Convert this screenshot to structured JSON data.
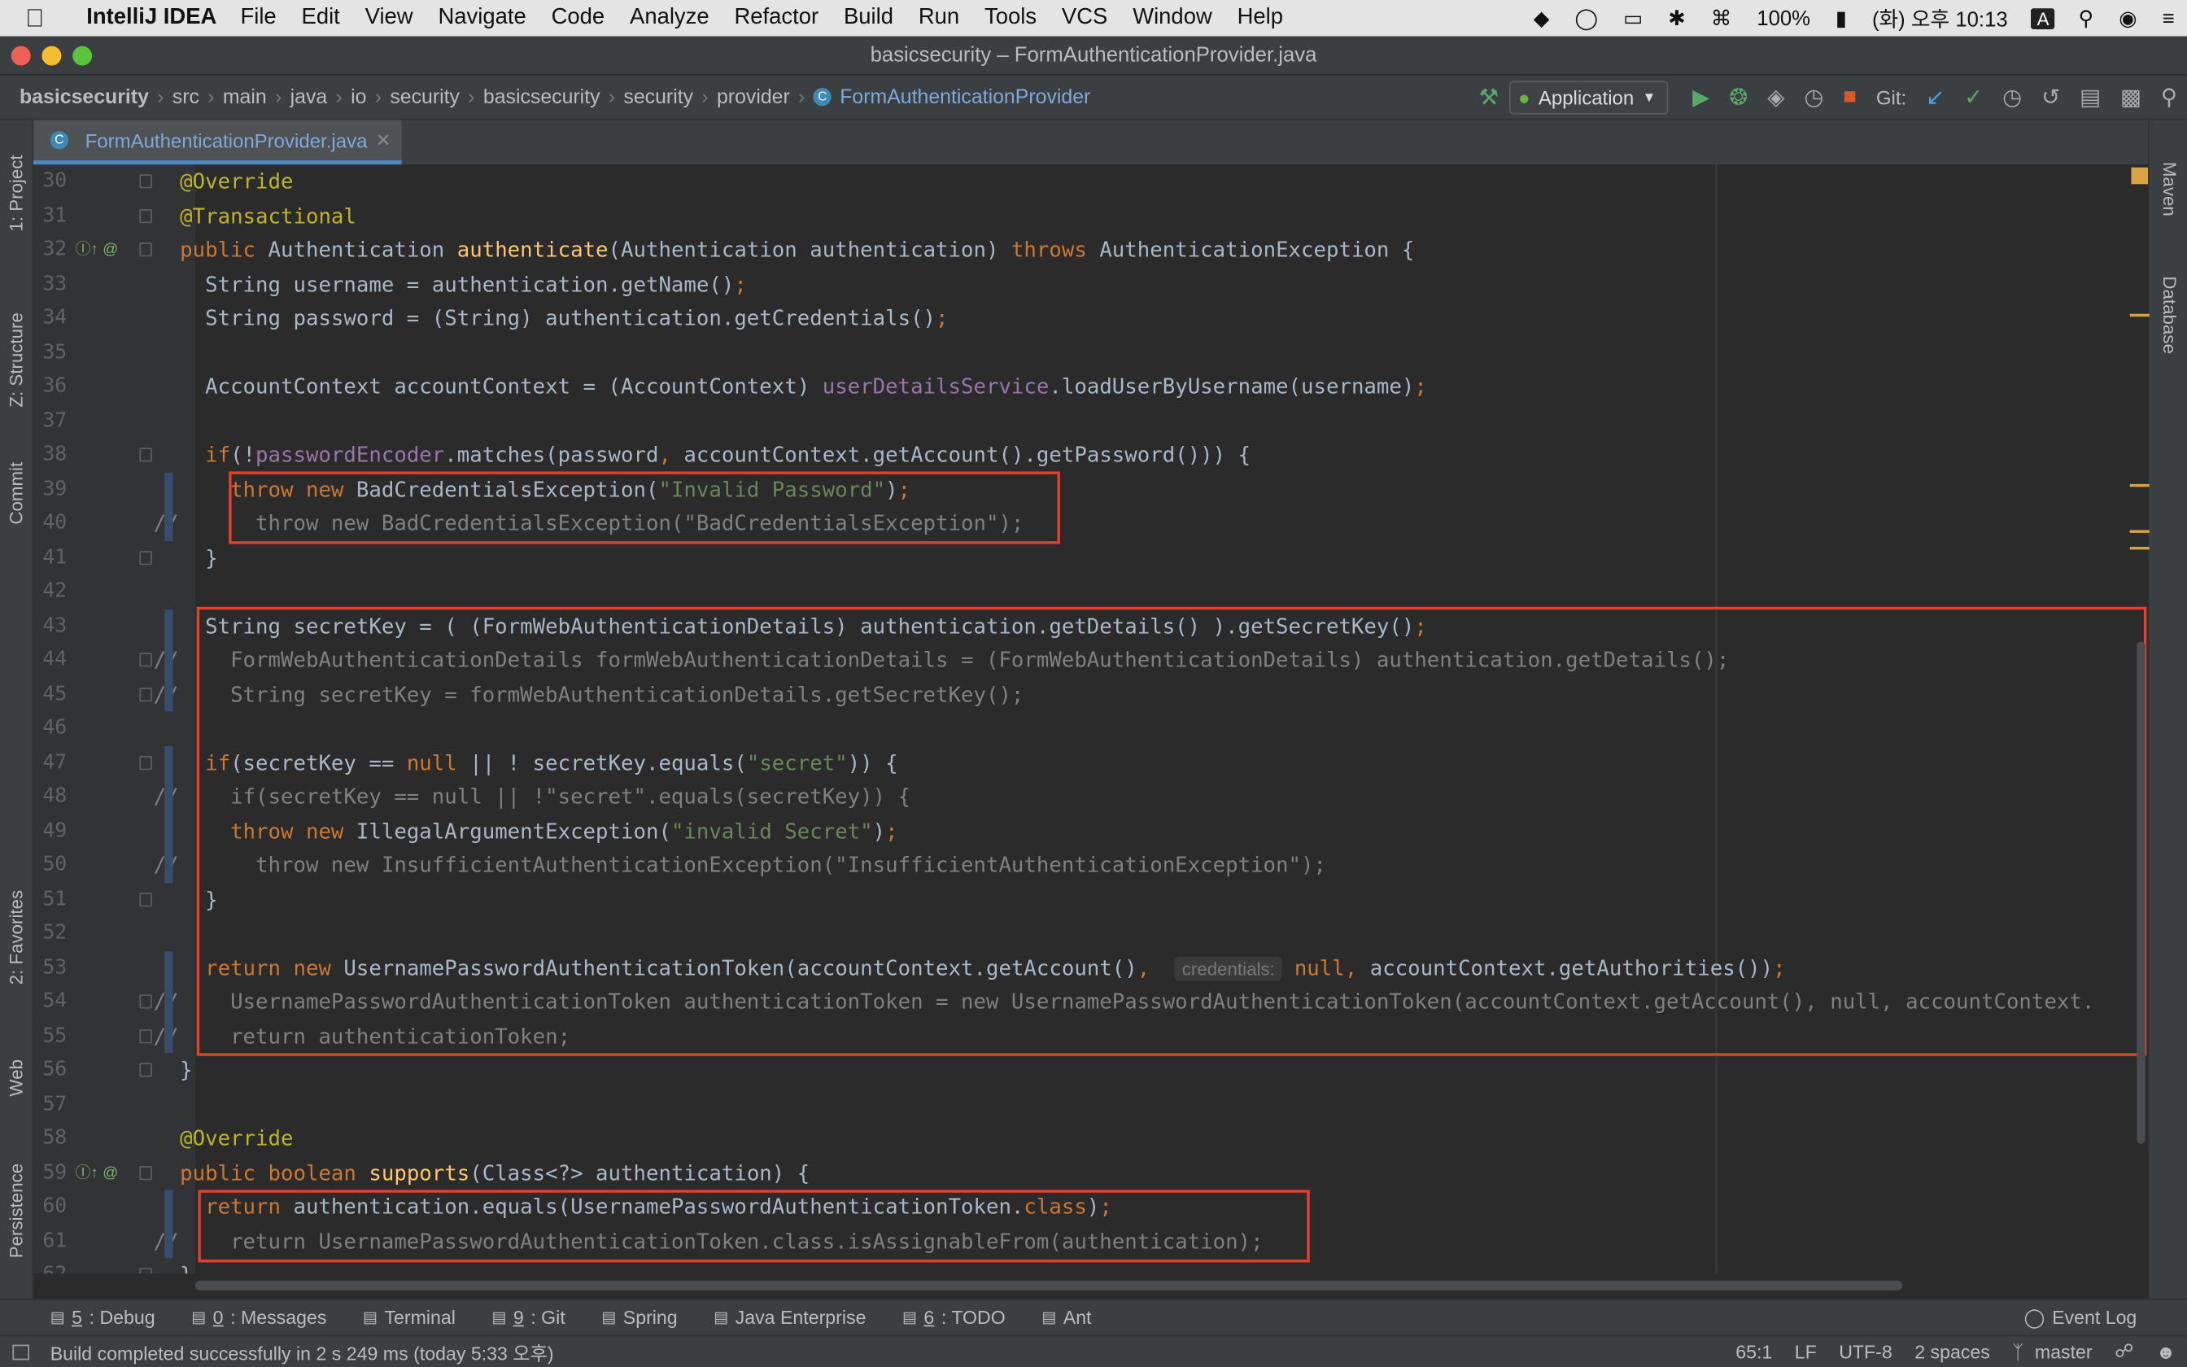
{
  "menubar": {
    "app": "IntelliJ IDEA",
    "items": [
      "File",
      "Edit",
      "View",
      "Navigate",
      "Code",
      "Analyze",
      "Refactor",
      "Build",
      "Run",
      "Tools",
      "VCS",
      "Window",
      "Help"
    ],
    "battery": "100%",
    "datetime": "(화) 오후 10:13",
    "input_source": "A"
  },
  "window": {
    "title": "basicsecurity – FormAuthenticationProvider.java"
  },
  "breadcrumbs": [
    "basicsecurity",
    "src",
    "main",
    "java",
    "io",
    "security",
    "basicsecurity",
    "security",
    "provider",
    "FormAuthenticationProvider"
  ],
  "toolbar": {
    "run_config": "Application",
    "git_label": "Git:"
  },
  "tab": {
    "label": "FormAuthenticationProvider.java"
  },
  "left_tools": [
    "1: Project",
    "Z: Structure",
    "Commit",
    "2: Favorites",
    "Web",
    "Persistence"
  ],
  "right_tools": [
    "Maven",
    "Database"
  ],
  "code": {
    "lines": [
      {
        "n": "30",
        "cm": "",
        "html": "<span class='a'>@Override</span>",
        "indent": 0
      },
      {
        "n": "31",
        "cm": "",
        "html": "<span class='a'>@Transactional</span>",
        "indent": 0
      },
      {
        "n": "32",
        "cm": "",
        "html": "<span class='k'>public </span>Authentication <span class='f'>authenticate</span>(Authentication authentication) <span class='k'>throws </span>AuthenticationException {",
        "indent": 0
      },
      {
        "n": "33",
        "cm": "",
        "html": "  String username = authentication.getName()<span class='k'>;</span>",
        "indent": 0
      },
      {
        "n": "34",
        "cm": "",
        "html": "  String password = (String) authentication.getCredentials()<span class='k'>;</span>",
        "indent": 0
      },
      {
        "n": "35",
        "cm": "",
        "html": "",
        "indent": 0
      },
      {
        "n": "36",
        "cm": "",
        "html": "  AccountContext accountContext = (AccountContext) <span class='v'>userDetailsService</span>.loadUserByUsername(username)<span class='k'>;</span>",
        "indent": 0
      },
      {
        "n": "37",
        "cm": "",
        "html": "",
        "indent": 0
      },
      {
        "n": "38",
        "cm": "",
        "html": "  <span class='k'>if</span>(!<span class='v'>passwordEncoder</span>.matches(password<span class='k'>, </span>accountContext.getAccount().getPassword())) {",
        "indent": 0
      },
      {
        "n": "39",
        "cm": "",
        "html": "    <span class='k'>throw new </span>BadCredentialsException(<span class='s'>\"Invalid Password\"</span>)<span class='k'>;</span>",
        "indent": 0
      },
      {
        "n": "40",
        "cm": "//",
        "html": "<span class='d'>      throw new BadCredentialsException(\"BadCredentialsException\");</span>",
        "indent": 0
      },
      {
        "n": "41",
        "cm": "",
        "html": "  }",
        "indent": 0
      },
      {
        "n": "42",
        "cm": "",
        "html": "",
        "indent": 0
      },
      {
        "n": "43",
        "cm": "",
        "html": "  String secretKey = ( (FormWebAuthenticationDetails) authentication.getDetails() ).getSecretKey()<span class='k'>;</span>",
        "indent": 0
      },
      {
        "n": "44",
        "cm": "//",
        "html": "<span class='d'>    FormWebAuthenticationDetails formWebAuthenticationDetails = (FormWebAuthenticationDetails) authentication.getDetails();</span>",
        "indent": 0
      },
      {
        "n": "45",
        "cm": "//",
        "html": "<span class='d'>    String secretKey = formWebAuthenticationDetails.getSecretKey();</span>",
        "indent": 0
      },
      {
        "n": "46",
        "cm": "",
        "html": "",
        "indent": 0
      },
      {
        "n": "47",
        "cm": "",
        "html": "  <span class='k'>if</span>(secretKey == <span class='k'>null </span>|| ! secretKey.equals(<span class='s'>\"secret\"</span>)) {",
        "indent": 0
      },
      {
        "n": "48",
        "cm": "//",
        "html": "<span class='d'>    if(secretKey == null || !\"secret\".equals(secretKey)) {</span>",
        "indent": 0
      },
      {
        "n": "49",
        "cm": "",
        "html": "    <span class='k'>throw new </span>IllegalArgumentException(<span class='s'>\"invalid Secret\"</span>)<span class='k'>;</span>",
        "indent": 0
      },
      {
        "n": "50",
        "cm": "//",
        "html": "<span class='d'>      throw new InsufficientAuthenticationException(\"InsufficientAuthenticationException\");</span>",
        "indent": 0
      },
      {
        "n": "51",
        "cm": "",
        "html": "  }",
        "indent": 0
      },
      {
        "n": "52",
        "cm": "",
        "html": "",
        "indent": 0
      },
      {
        "n": "53",
        "cm": "",
        "html": "  <span class='k'>return new </span>UsernamePasswordAuthenticationToken(accountContext.getAccount()<span class='k'>, </span> <span class='hint'>credentials:</span> <span class='k'>null, </span>accountContext.getAuthorities())<span class='k'>;</span>",
        "indent": 0
      },
      {
        "n": "54",
        "cm": "//",
        "html": "<span class='d'>    UsernamePasswordAuthenticationToken authenticationToken = new UsernamePasswordAuthenticationToken(accountContext.getAccount(), null, accountContext.</span>",
        "indent": 0
      },
      {
        "n": "55",
        "cm": "//",
        "html": "<span class='d'>    return authenticationToken;</span>",
        "indent": 0
      },
      {
        "n": "56",
        "cm": "",
        "html": "}",
        "indent": 0
      },
      {
        "n": "57",
        "cm": "",
        "html": "",
        "indent": 0
      },
      {
        "n": "58",
        "cm": "",
        "html": "<span class='a'>@Override</span>",
        "indent": 0
      },
      {
        "n": "59",
        "cm": "",
        "html": "<span class='k'>public boolean </span><span class='f'>supports</span>(Class&lt;?&gt; authentication) {",
        "indent": 0
      },
      {
        "n": "60",
        "cm": "",
        "html": "  <span class='k'>return </span>authentication.equals(UsernamePasswordAuthenticationToken.<span class='k'>class</span>)<span class='k'>;</span>",
        "indent": 0
      },
      {
        "n": "61",
        "cm": "//",
        "html": "<span class='d'>    return UsernamePasswordAuthenticationToken.class.isAssignableFrom(authentication);</span>",
        "indent": 0
      },
      {
        "n": "62",
        "cm": "",
        "html": "}",
        "indent": 0
      }
    ]
  },
  "bottom_tools": [
    {
      "key": "5",
      "label": ": Debug",
      "icon": "bug-icon"
    },
    {
      "key": "0",
      "label": ": Messages",
      "icon": "messages-icon"
    },
    {
      "key": "",
      "label": "Terminal",
      "icon": "terminal-icon"
    },
    {
      "key": "9",
      "label": ": Git",
      "icon": "git-icon"
    },
    {
      "key": "",
      "label": "Spring",
      "icon": "spring-icon"
    },
    {
      "key": "",
      "label": "Java Enterprise",
      "icon": "java-enterprise-icon"
    },
    {
      "key": "6",
      "label": ": TODO",
      "icon": "todo-icon"
    },
    {
      "key": "",
      "label": "Ant",
      "icon": "ant-icon"
    }
  ],
  "event_log": "Event Log",
  "status": {
    "message": "Build completed successfully in 2 s 249 ms (today 5:33 오후)",
    "position": "65:1",
    "line_sep": "LF",
    "encoding": "UTF-8",
    "indent": "2 spaces",
    "branch": "master"
  }
}
